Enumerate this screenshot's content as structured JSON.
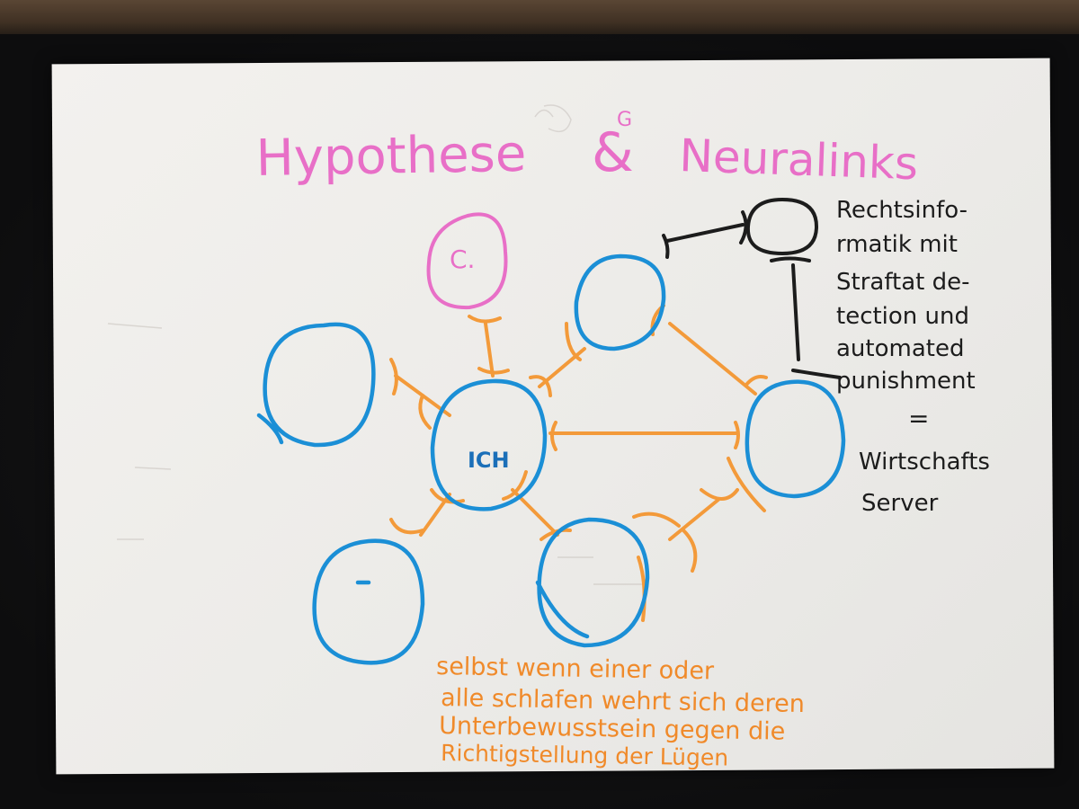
{
  "colors": {
    "paper": "#efedea",
    "pink": "#e86fc7",
    "blue": "#1b8fd6",
    "orange": "#f39a3a",
    "black": "#1c1c1c"
  },
  "title": {
    "part1": "Hypothese",
    "amp": "&",
    "amp_small": "G",
    "part2": "Neuralinks"
  },
  "nodes": {
    "top": "C.",
    "center": "ICH"
  },
  "side_note": {
    "lines": [
      "Rechtsinfo-",
      "rmatik mit",
      "Straftat de-",
      "tection und",
      "automated",
      "punishment",
      "=",
      "Wirtschafts",
      "Server"
    ]
  },
  "bottom_note": {
    "lines": [
      "selbst wenn einer oder",
      "alle schlafen wehrt sich deren",
      "Unterbewusstsein gegen die",
      "Richtigstellung der Lügen"
    ]
  }
}
